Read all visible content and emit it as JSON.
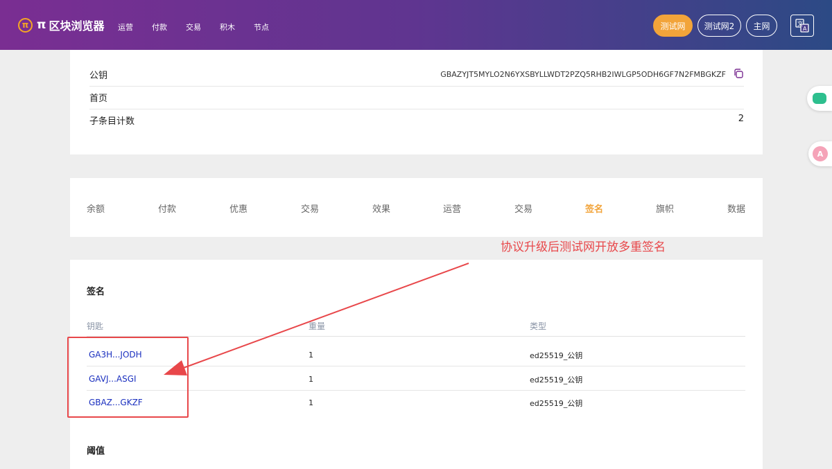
{
  "header": {
    "logo_symbol": "π",
    "logo_pi": "π",
    "logo_text": "区块浏览器",
    "nav": [
      "运营",
      "付款",
      "交易",
      "积木",
      "节点"
    ],
    "network_buttons": [
      "测试网",
      "测试网2",
      "主网"
    ],
    "active_network": "测试网",
    "language_icon": "translate-icon"
  },
  "account": {
    "public_key_label": "公钥",
    "public_key_value": "GBAZYJT5MYLO2N6YXSBYLLWDT2PZQ5RHB2IWLGP5ODH6GF7N2FMBGKZF",
    "home_label": "首页",
    "home_value": "",
    "subentry_label": "子条目计数",
    "subentry_value": "2"
  },
  "tabs": {
    "items": [
      "余额",
      "付款",
      "优惠",
      "交易",
      "效果",
      "运营",
      "交易",
      "签名",
      "旗帜",
      "数据"
    ],
    "active": "签名"
  },
  "signers": {
    "title": "签名",
    "columns": [
      "钥匙",
      "重量",
      "类型"
    ],
    "rows": [
      {
        "key": "GA3H...JODH",
        "weight": "1",
        "type": "ed25519_公钥"
      },
      {
        "key": "GAVJ...ASGI",
        "weight": "1",
        "type": "ed25519_公钥"
      },
      {
        "key": "GBAZ...GKZF",
        "weight": "1",
        "type": "ed25519_公钥"
      }
    ]
  },
  "thresholds": {
    "title": "阈值"
  },
  "annotation": {
    "text": "协议升级后测试网开放多重签名",
    "color": "#e8474a"
  },
  "colors": {
    "accent": "#f2a43a",
    "link": "#1a2fbf",
    "header_start": "#7a2e92",
    "header_end": "#2c4a85"
  }
}
